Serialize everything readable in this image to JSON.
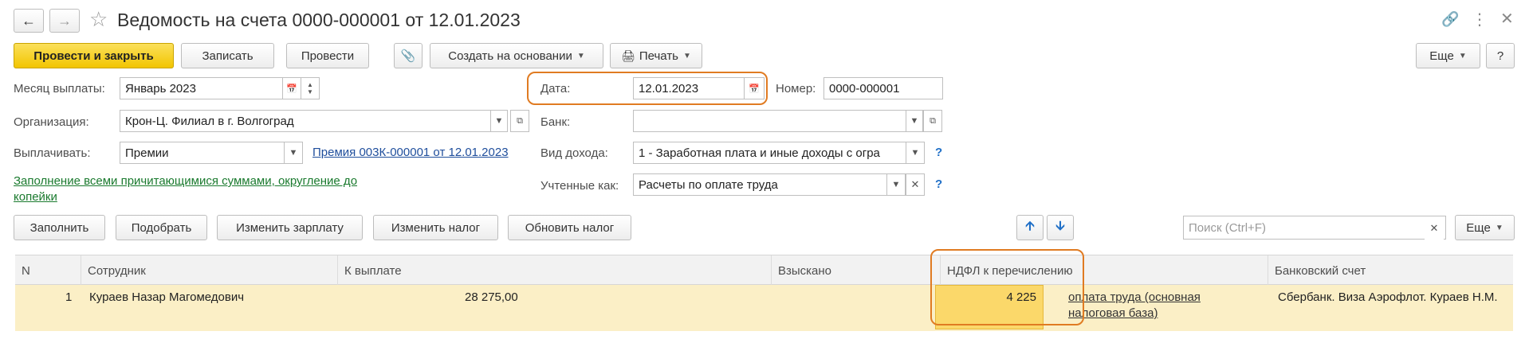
{
  "title": "Ведомость на счета 0000-000001 от 12.01.2023",
  "toolbar": {
    "post_close": "Провести и закрыть",
    "save": "Записать",
    "post": "Провести",
    "create_based": "Создать на основании",
    "print": "Печать",
    "more": "Еще",
    "help": "?"
  },
  "form": {
    "month_label": "Месяц выплаты:",
    "month_value": "Январь 2023",
    "date_label": "Дата:",
    "date_value": "12.01.2023",
    "number_label": "Номер:",
    "number_value": "0000-000001",
    "org_label": "Организация:",
    "org_value": "Крон-Ц. Филиал в г. Волгоград",
    "bank_label": "Банк:",
    "bank_value": "",
    "pay_label": "Выплачивать:",
    "pay_value": "Премии",
    "pay_link": "Премия 003К-000001 от 12.01.2023",
    "income_label": "Вид дохода:",
    "income_value": "1 - Заработная плата и иные доходы с огра",
    "accounted_label": "Учтенные как:",
    "accounted_value": "Расчеты по оплате труда",
    "fill_link": "Заполнение всеми причитающимися суммами, округление до копейки"
  },
  "table_toolbar": {
    "fill": "Заполнить",
    "select": "Подобрать",
    "change_salary": "Изменить зарплату",
    "change_tax": "Изменить налог",
    "update_tax": "Обновить налог",
    "search_placeholder": "Поиск (Ctrl+F)",
    "more": "Еще"
  },
  "table": {
    "columns": [
      "N",
      "Сотрудник",
      "К выплате",
      "Взыскано",
      "НДФЛ к перечислению",
      "Банковский счет"
    ],
    "rows": [
      {
        "n": "1",
        "employee": "Кураев Назар Магомедович",
        "to_pay": "28 275,00",
        "withheld": "",
        "ndfl": "4 225",
        "ndfl_note": "оплата труда (основная налоговая база)",
        "bank_account": "Сбербанк. Виза Аэрофлот. Кураев Н.М."
      }
    ]
  },
  "colors": {
    "primary_button": "#f2c500",
    "highlight_border": "#e07b22",
    "row_selected": "#fbefc6",
    "cell_active": "#fbd86a",
    "link": "#1f4e9c",
    "green_link": "#1a7a2e"
  },
  "icons": [
    "back-arrow-icon",
    "forward-arrow-icon",
    "star-icon",
    "link-icon",
    "more-vertical-icon",
    "close-icon",
    "paperclip-icon",
    "printer-icon",
    "calendar-icon",
    "open-form-icon",
    "clear-icon",
    "arrow-up-icon",
    "arrow-down-icon"
  ]
}
